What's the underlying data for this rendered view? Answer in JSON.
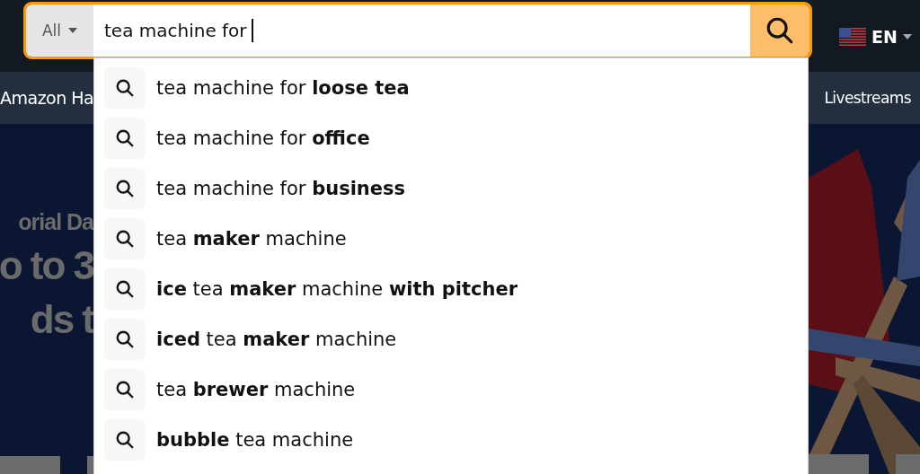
{
  "search": {
    "category": "All",
    "value": "tea machine for"
  },
  "language": {
    "code": "EN"
  },
  "nav": {
    "left": "Amazon Ha",
    "right": "Livestreams"
  },
  "hero": {
    "lines": [
      "orial Da",
      "o to 3",
      "ds t"
    ]
  },
  "suggestions": [
    {
      "text": "tea machine for **loose tea**"
    },
    {
      "text": "tea machine for **office**"
    },
    {
      "text": "tea machine for **business**"
    },
    {
      "text": "tea **maker** machine"
    },
    {
      "text": "**ice** tea **maker** machine **with pitcher**"
    },
    {
      "text": "**iced** tea **maker** machine"
    },
    {
      "text": "tea **brewer** machine"
    },
    {
      "text": "**bubble** tea machine"
    }
  ]
}
